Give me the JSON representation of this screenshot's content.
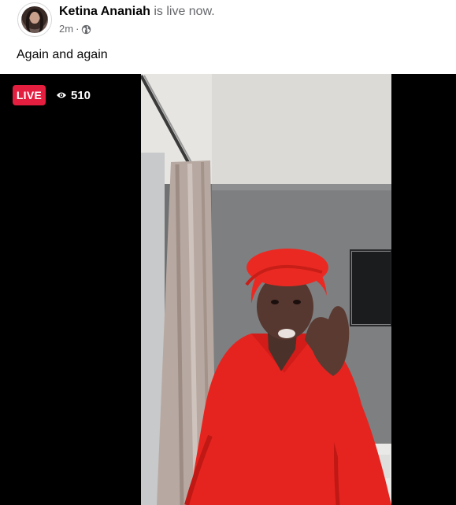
{
  "post": {
    "author_name": "Ketina Ananiah",
    "status_text": "is live now.",
    "time": "2m",
    "separator": "·",
    "audience_icon": "globe-icon",
    "caption": "Again and again"
  },
  "video": {
    "live_label": "LIVE",
    "viewer_icon": "eye-icon",
    "viewer_count": "510"
  },
  "colors": {
    "live_red": "#e41e3f",
    "text_primary": "#050505",
    "text_secondary": "#65676b",
    "scene_wall": "#7d7e80",
    "dress_red": "#e5241f"
  }
}
